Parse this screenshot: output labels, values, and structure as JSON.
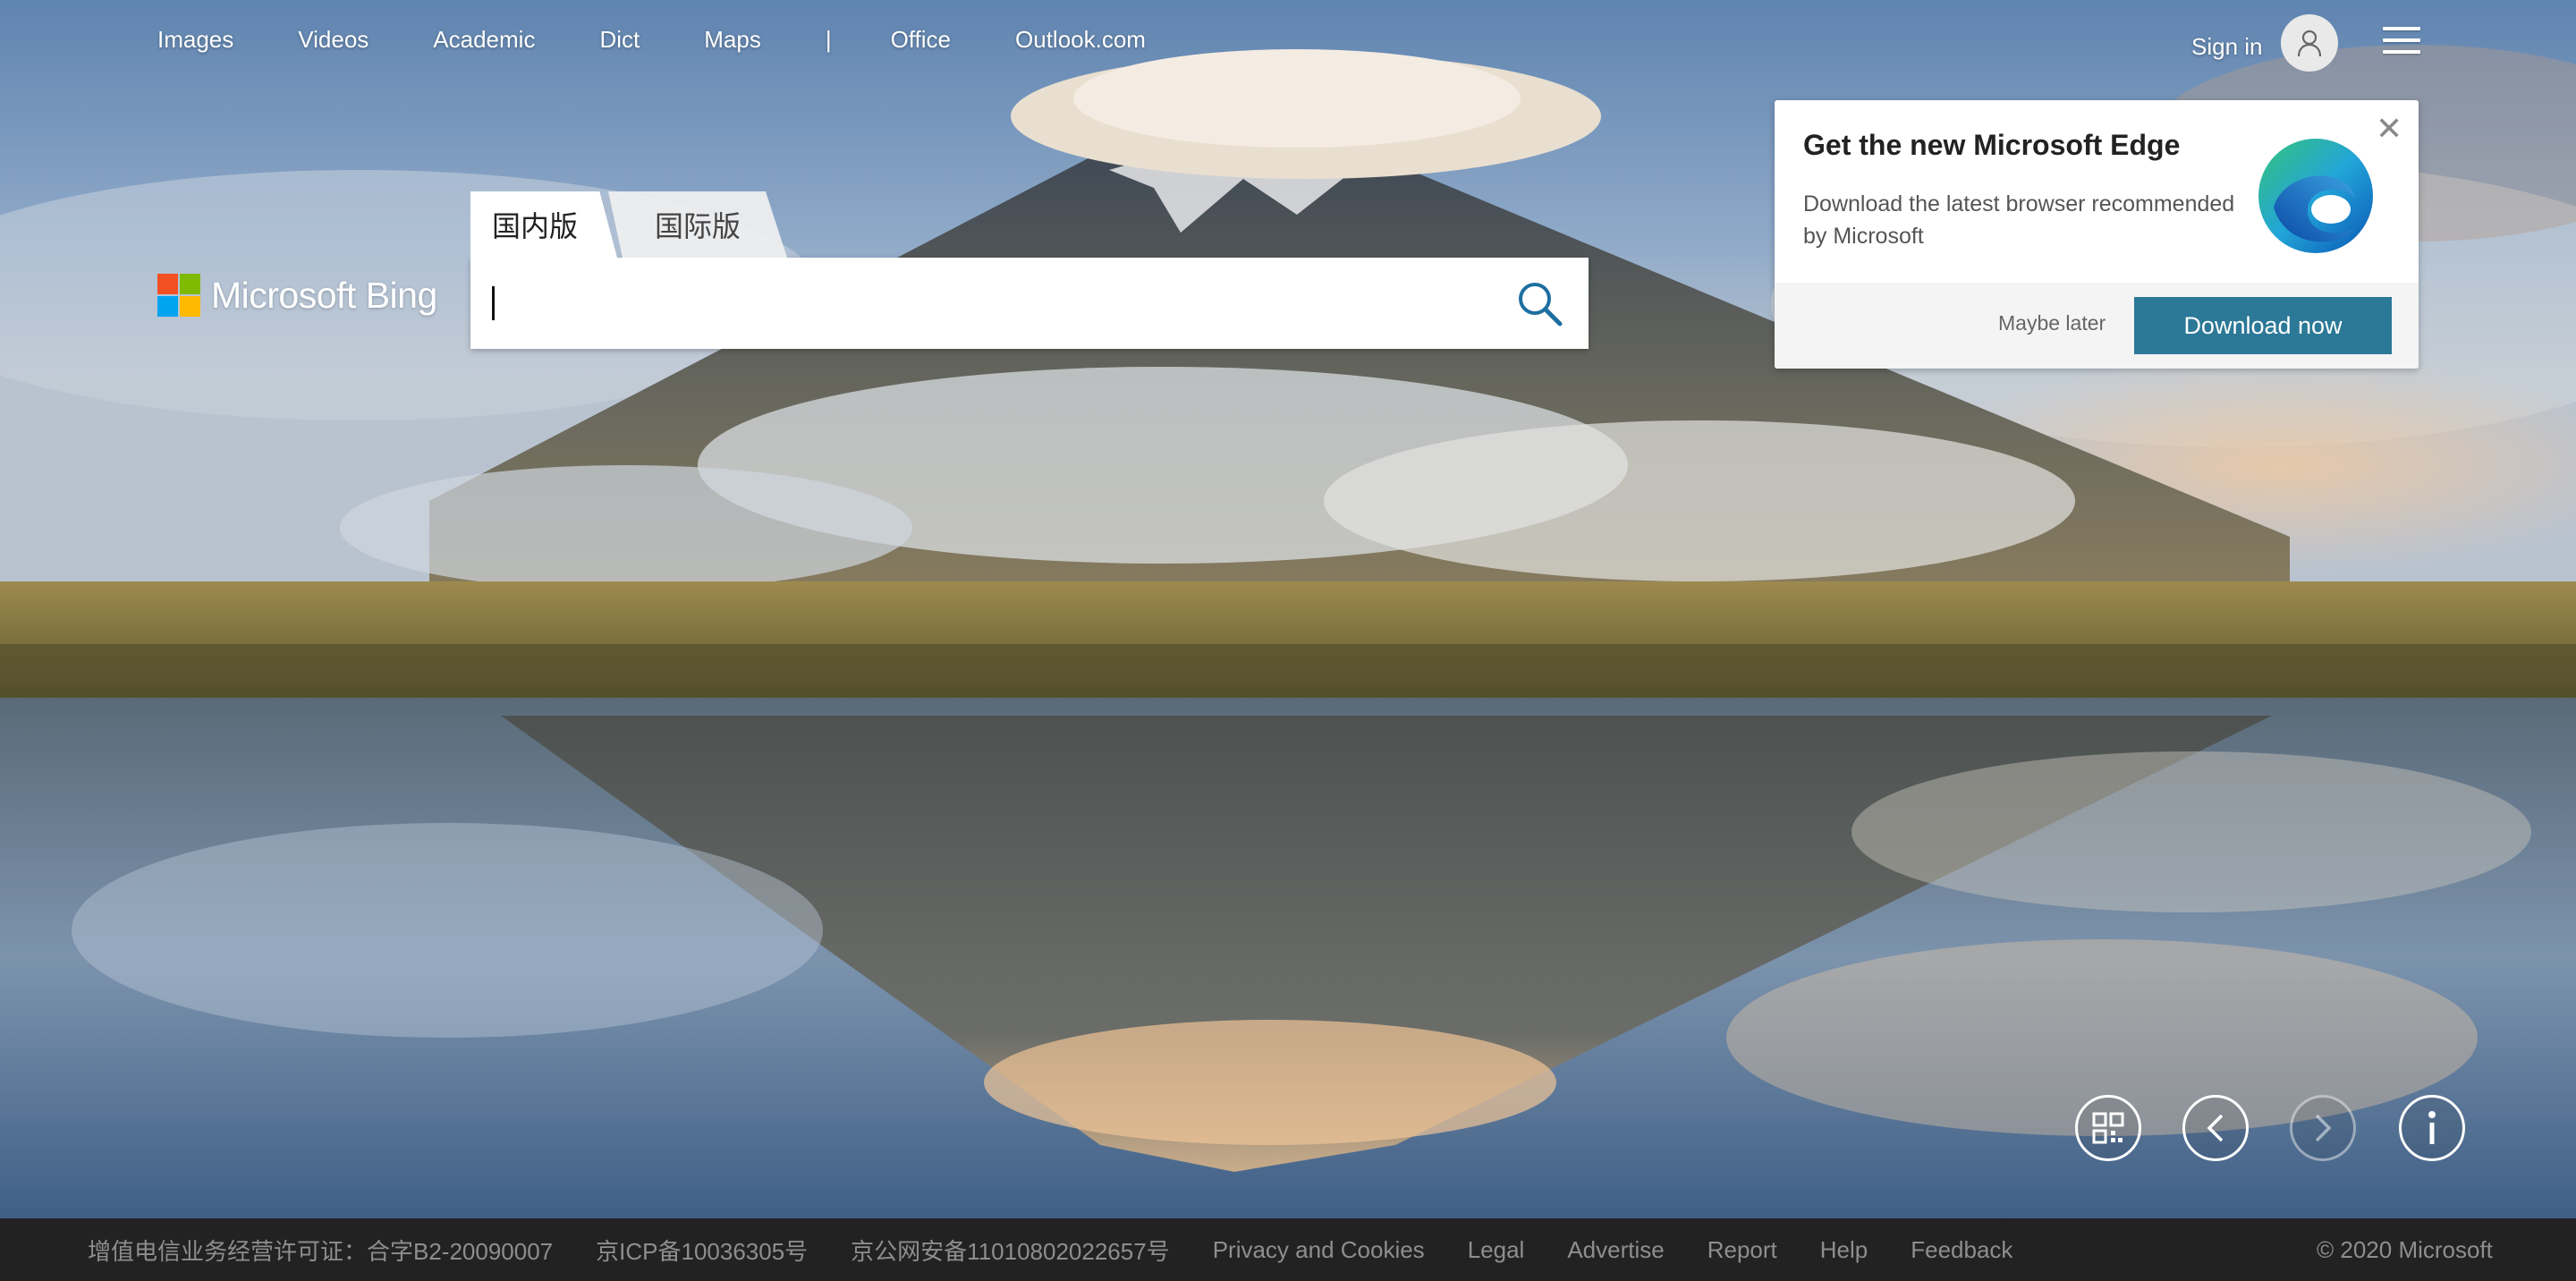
{
  "nav": {
    "links": [
      "Images",
      "Videos",
      "Academic",
      "Dict",
      "Maps",
      "|",
      "Office",
      "Outlook.com"
    ],
    "sign_in": "Sign in"
  },
  "logo": {
    "text": "Microsoft Bing"
  },
  "search": {
    "tabs": [
      "国内版",
      "国际版"
    ],
    "active_tab": "国内版",
    "value": "",
    "placeholder": ""
  },
  "promo": {
    "title": "Get the new Microsoft Edge",
    "description": "Download the latest browser recommended by Microsoft",
    "close_label": "✕",
    "secondary": "Maybe later",
    "primary": "Download now"
  },
  "controls": [
    "qr-code-icon",
    "chevron-left-icon",
    "chevron-right-icon",
    "info-icon"
  ],
  "footer": {
    "license": "增值电信业务经营许可证：合字B2-20090007",
    "icp": "京ICP备10036305号",
    "police": "京公网安备11010802022657号",
    "privacy": "Privacy and Cookies",
    "legal": "Legal",
    "advertise": "Advertise",
    "report": "Report",
    "help": "Help",
    "feedback": "Feedback",
    "copyright": "© 2020 Microsoft"
  },
  "colors": {
    "accent": "#2b7897",
    "footer_bg": "#222222",
    "logo_red": "#f25022",
    "logo_green": "#7fba00",
    "logo_blue": "#00a4ef",
    "logo_yellow": "#ffb900"
  }
}
